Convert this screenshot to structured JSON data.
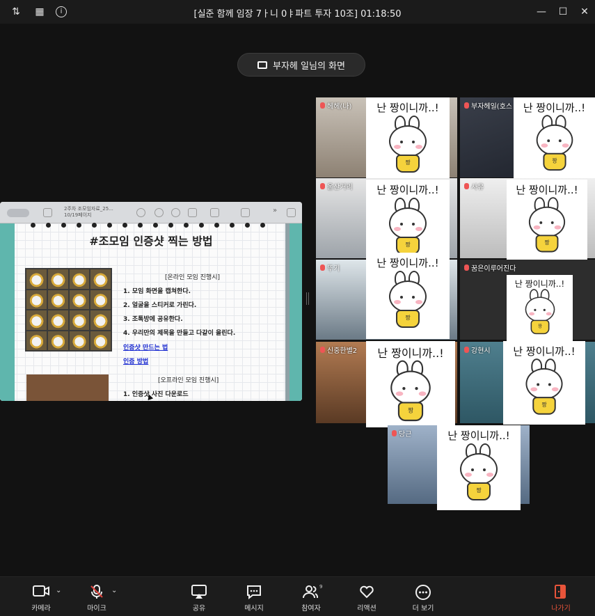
{
  "window": {
    "title": "[실준 함께 임장 7ㅏ니 0ㅑ파트 투자 10조] 01:18:50",
    "left_icons": [
      "sort-icon",
      "grid-view-icon",
      "info-icon"
    ],
    "right_icons": [
      "minimize-icon",
      "maximize-icon",
      "close-icon"
    ],
    "controls": {
      "minimize": "—",
      "maximize": "☐",
      "close": "✕"
    }
  },
  "share_banner": {
    "label": "부자헤 일님의 화면"
  },
  "shared_screen": {
    "file_name": "2주차 조모임자료_25...",
    "file_sub": "10/19페이지",
    "doc_title": "#조모임 인증샷 찍는 방법",
    "online_heading": "[온라인 모임 진행시]",
    "steps": [
      "1. 모임 화면을 캡쳐한다.",
      "2. 얼굴을 스티커로 가린다.",
      "3. 조톡방에 공유한다.",
      "4. 우리만의 제목을 만들고 다같이 올린다."
    ],
    "link1": "인증샷 만드는 법",
    "link2": "인증 방법",
    "offline_heading": "[오프라인 모임 진행시]",
    "offline_first": "1. 인증샷 사진 다운로드"
  },
  "sticker_caption": "난 짱이니까..!",
  "sticker_shirt": "짱",
  "participants": [
    {
      "name": "헤헤(나)"
    },
    {
      "name": "부자헤일(호스"
    },
    {
      "name": "울산거리"
    },
    {
      "name": "사유"
    },
    {
      "name": "뚜기"
    },
    {
      "name": "꿈은이루어진다"
    },
    {
      "name": "신중한별2"
    },
    {
      "name": "강현시"
    },
    {
      "name": "당근"
    }
  ],
  "toolbar": {
    "camera": "카메라",
    "mic": "마이크",
    "share": "공유",
    "message": "메시지",
    "participants": "참여자",
    "participants_count": "9",
    "reaction": "리액션",
    "more": "더 보기",
    "leave": "나가기"
  },
  "colors": {
    "leave": "#e8543a",
    "mic_muted": "#e0443e",
    "link": "#1a2ad0",
    "teal": "#5fb6ad"
  }
}
